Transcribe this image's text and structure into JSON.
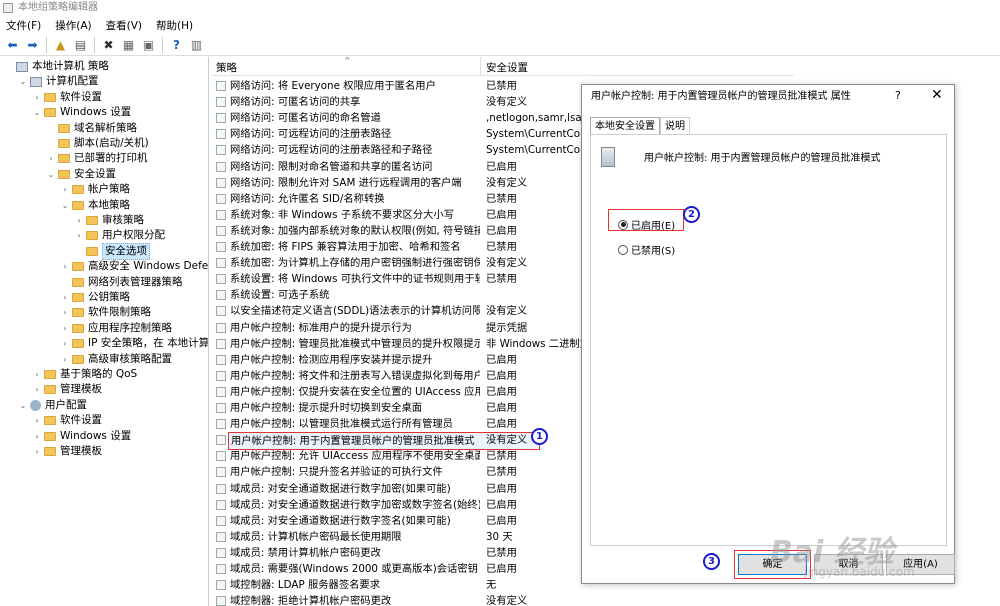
{
  "window": {
    "title": "本地组策略编辑器"
  },
  "menu": [
    "文件(F)",
    "操作(A)",
    "查看(V)",
    "帮助(H)"
  ],
  "tree": [
    {
      "label": "本地计算机 策略",
      "level": 0,
      "toggle": "",
      "icon": "computer"
    },
    {
      "label": "计算机配置",
      "level": 1,
      "toggle": "v",
      "icon": "computer"
    },
    {
      "label": "软件设置",
      "level": 2,
      "toggle": ">",
      "icon": "folder"
    },
    {
      "label": "Windows 设置",
      "level": 2,
      "toggle": "v",
      "icon": "folder"
    },
    {
      "label": "域名解析策略",
      "level": 3,
      "toggle": "",
      "icon": "folder"
    },
    {
      "label": "脚本(启动/关机)",
      "level": 3,
      "toggle": "",
      "icon": "folder"
    },
    {
      "label": "已部署的打印机",
      "level": 3,
      "toggle": ">",
      "icon": "folder"
    },
    {
      "label": "安全设置",
      "level": 3,
      "toggle": "v",
      "icon": "folder"
    },
    {
      "label": "帐户策略",
      "level": 4,
      "toggle": ">",
      "icon": "folder"
    },
    {
      "label": "本地策略",
      "level": 4,
      "toggle": "v",
      "icon": "folder"
    },
    {
      "label": "审核策略",
      "level": 5,
      "toggle": ">",
      "icon": "folder"
    },
    {
      "label": "用户权限分配",
      "level": 5,
      "toggle": ">",
      "icon": "folder"
    },
    {
      "label": "安全选项",
      "level": 5,
      "toggle": "",
      "icon": "folder",
      "selected": true
    },
    {
      "label": "高级安全 Windows Defender",
      "level": 4,
      "toggle": ">",
      "icon": "folder"
    },
    {
      "label": "网络列表管理器策略",
      "level": 4,
      "toggle": "",
      "icon": "folder"
    },
    {
      "label": "公钥策略",
      "level": 4,
      "toggle": ">",
      "icon": "folder"
    },
    {
      "label": "软件限制策略",
      "level": 4,
      "toggle": ">",
      "icon": "folder"
    },
    {
      "label": "应用程序控制策略",
      "level": 4,
      "toggle": ">",
      "icon": "folder"
    },
    {
      "label": "IP 安全策略，在 本地计算机",
      "level": 4,
      "toggle": ">",
      "icon": "folder"
    },
    {
      "label": "高级审核策略配置",
      "level": 4,
      "toggle": ">",
      "icon": "folder"
    },
    {
      "label": "基于策略的 QoS",
      "level": 2,
      "toggle": ">",
      "icon": "folder"
    },
    {
      "label": "管理模板",
      "level": 2,
      "toggle": ">",
      "icon": "folder"
    },
    {
      "label": "用户配置",
      "level": 1,
      "toggle": "v",
      "icon": "user"
    },
    {
      "label": "软件设置",
      "level": 2,
      "toggle": ">",
      "icon": "folder"
    },
    {
      "label": "Windows 设置",
      "level": 2,
      "toggle": ">",
      "icon": "folder"
    },
    {
      "label": "管理模板",
      "level": 2,
      "toggle": ">",
      "icon": "folder"
    }
  ],
  "list": {
    "col_policy": "策略",
    "col_setting": "安全设置",
    "rows": [
      {
        "policy": "网络访问: 将 Everyone 权限应用于匿名用户",
        "value": "已禁用"
      },
      {
        "policy": "网络访问: 可匿名访问的共享",
        "value": "没有定义"
      },
      {
        "policy": "网络访问: 可匿名访问的命名管道",
        "value": ",netlogon,samr,lsarpc"
      },
      {
        "policy": "网络访问: 可远程访问的注册表路径",
        "value": "System\\CurrentContro"
      },
      {
        "policy": "网络访问: 可远程访问的注册表路径和子路径",
        "value": "System\\CurrentContro"
      },
      {
        "policy": "网络访问: 限制对命名管道和共享的匿名访问",
        "value": "已启用"
      },
      {
        "policy": "网络访问: 限制允许对 SAM 进行远程调用的客户端",
        "value": "没有定义"
      },
      {
        "policy": "网络访问: 允许匿名 SID/名称转换",
        "value": "已禁用"
      },
      {
        "policy": "系统对象: 非 Windows 子系统不要求区分大小写",
        "value": "已启用"
      },
      {
        "policy": "系统对象: 加强内部系统对象的默认权限(例如, 符号链接)",
        "value": "已启用"
      },
      {
        "policy": "系统加密: 将 FIPS 兼容算法用于加密、哈希和签名",
        "value": "已禁用"
      },
      {
        "policy": "系统加密: 为计算机上存储的用户密钥强制进行强密钥保护",
        "value": "没有定义"
      },
      {
        "policy": "系统设置: 将 Windows 可执行文件中的证书规则用于软件...",
        "value": "已禁用"
      },
      {
        "policy": "系统设置: 可选子系统",
        "value": ""
      },
      {
        "policy": "以安全描述符定义语言(SDDL)语法表示的计算机访问限制",
        "value": "没有定义"
      },
      {
        "policy": "用户帐户控制: 标准用户的提升提示行为",
        "value": "提示凭据"
      },
      {
        "policy": "用户帐户控制: 管理员批准模式中管理员的提升权限提示的...",
        "value": "非 Windows 二进制文..."
      },
      {
        "policy": "用户帐户控制: 检测应用程序安装并提示提升",
        "value": "已启用"
      },
      {
        "policy": "用户帐户控制: 将文件和注册表写入错误虚拟化到每用户位置",
        "value": "已启用"
      },
      {
        "policy": "用户帐户控制: 仅提升安装在安全位置的 UIAccess 应用程序",
        "value": "已启用"
      },
      {
        "policy": "用户帐户控制: 提示提升时切换到安全桌面",
        "value": "已启用"
      },
      {
        "policy": "用户帐户控制: 以管理员批准模式运行所有管理员",
        "value": "已启用"
      },
      {
        "policy": "用户帐户控制: 用于内置管理员帐户的管理员批准模式",
        "value": "没有定义",
        "highlight": true
      },
      {
        "policy": "用户帐户控制: 允许 UIAccess 应用程序不使用安全桌面...",
        "value": "已禁用"
      },
      {
        "policy": "用户帐户控制: 只提升签名并验证的可执行文件",
        "value": "已禁用"
      },
      {
        "policy": "域成员: 对安全通道数据进行数字加密(如果可能)",
        "value": "已启用"
      },
      {
        "policy": "域成员: 对安全通道数据进行数字加密或数字签名(始终)",
        "value": "已启用"
      },
      {
        "policy": "域成员: 对安全通道数据进行数字签名(如果可能)",
        "value": "已启用"
      },
      {
        "policy": "域成员: 计算机帐户密码最长使用期限",
        "value": "30 天"
      },
      {
        "policy": "域成员: 禁用计算机帐户密码更改",
        "value": "已禁用"
      },
      {
        "policy": "域成员: 需要强(Windows 2000 或更高版本)会话密钥",
        "value": "已启用"
      },
      {
        "policy": "域控制器: LDAP 服务器签名要求",
        "value": "无"
      },
      {
        "policy": "域控制器: 拒绝计算机帐户密码更改",
        "value": "没有定义"
      }
    ]
  },
  "dialog": {
    "title": "用户帐户控制: 用于内置管理员帐户的管理员批准模式 属性",
    "help": "?",
    "close": "✕",
    "tabs": [
      "本地安全设置",
      "说明"
    ],
    "policy_name": "用户帐户控制: 用于内置管理员帐户的管理员批准模式",
    "enabled_label": "已启用(E)",
    "disabled_label": "已禁用(S)",
    "selected_option": "enabled",
    "ok": "确定",
    "cancel": "取消",
    "apply": "应用(A)"
  },
  "markers": [
    "1",
    "2",
    "3"
  ],
  "watermark": {
    "brand": "Bai 经验",
    "url": "jingyan.baidu.com"
  }
}
